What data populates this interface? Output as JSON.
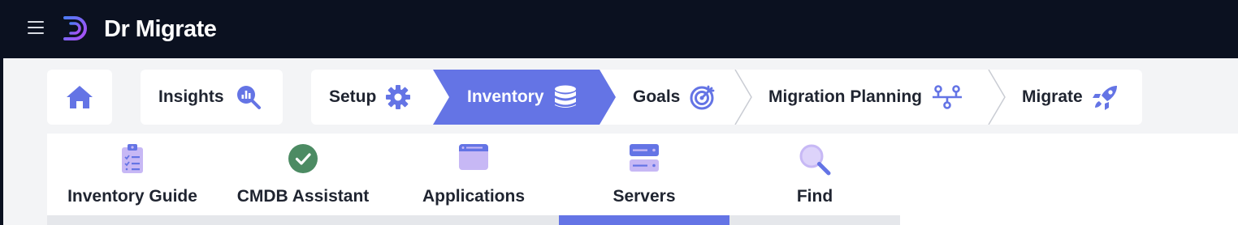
{
  "app": {
    "title": "Dr Migrate"
  },
  "colors": {
    "accent": "#6474e5",
    "topbar": "#0b1120",
    "success": "#4c8b63",
    "icon_light": "#c7b8f5"
  },
  "nav": {
    "home": {
      "icon": "home-icon"
    },
    "insights": {
      "label": "Insights",
      "icon": "chart-search-icon"
    },
    "steps": [
      {
        "label": "Setup",
        "icon": "gear-icon",
        "active": false
      },
      {
        "label": "Inventory",
        "icon": "database-icon",
        "active": true
      },
      {
        "label": "Goals",
        "icon": "target-icon",
        "active": false
      },
      {
        "label": "Migration Planning",
        "icon": "flow-icon",
        "active": false
      },
      {
        "label": "Migrate",
        "icon": "rocket-icon",
        "active": false
      }
    ]
  },
  "subnav": {
    "tabs": [
      {
        "label": "Inventory Guide",
        "icon": "clipboard-checklist-icon",
        "active": false
      },
      {
        "label": "CMDB Assistant",
        "icon": "check-circle-icon",
        "active": false
      },
      {
        "label": "Applications",
        "icon": "browser-window-icon",
        "active": false
      },
      {
        "label": "Servers",
        "icon": "server-icon",
        "active": true
      },
      {
        "label": "Find",
        "icon": "magnifier-icon",
        "active": false
      }
    ]
  }
}
